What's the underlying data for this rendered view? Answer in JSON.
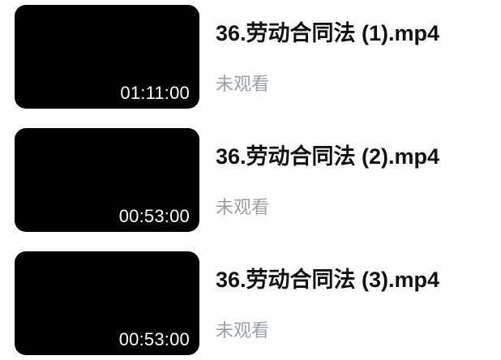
{
  "videos": [
    {
      "title": "36.劳动合同法 (1).mp4",
      "duration": "01:11:00",
      "status": "未观看"
    },
    {
      "title": "36.劳动合同法 (2).mp4",
      "duration": "00:53:00",
      "status": "未观看"
    },
    {
      "title": "36.劳动合同法 (3).mp4",
      "duration": "00:53:00",
      "status": "未观看"
    }
  ]
}
